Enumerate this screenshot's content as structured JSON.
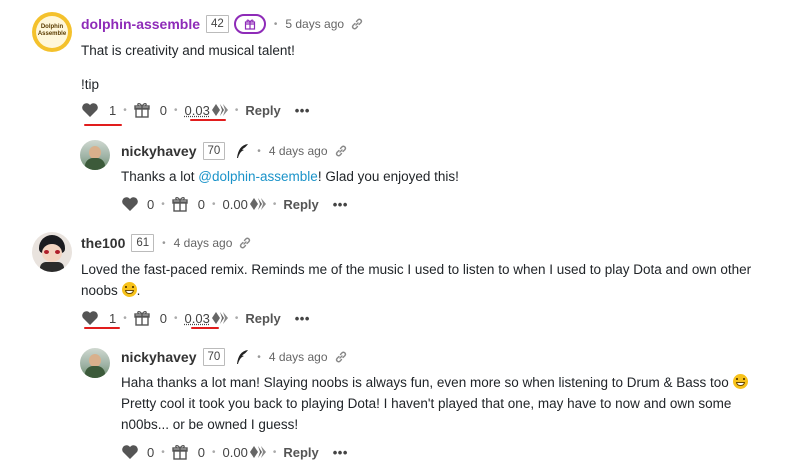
{
  "comments": [
    {
      "author": "dolphin-assemble",
      "reputation": "42",
      "time": "5 days ago",
      "avatar_text": "Dolphin Assemble",
      "body_line1": "That is creativity and musical talent!",
      "body_line2": "!tip",
      "votes": "1",
      "gifts": "0",
      "payout": "0.03",
      "reply": "Reply",
      "more": "•••"
    },
    {
      "author": "nickyhavey",
      "reputation": "70",
      "time": "4 days ago",
      "body_pre": "Thanks a lot ",
      "body_mention": "@dolphin-assemble",
      "body_post": "! Glad you enjoyed this!",
      "votes": "0",
      "gifts": "0",
      "payout": "0.00",
      "reply": "Reply",
      "more": "•••"
    },
    {
      "author": "the100",
      "reputation": "61",
      "time": "4 days ago",
      "body_line1": "Loved the fast-paced remix. Reminds me of the music I used to listen to when I used to play Dota and own other",
      "body_line2": "noobs",
      "body_line2_end": ".",
      "votes": "1",
      "gifts": "0",
      "payout": "0.03",
      "reply": "Reply",
      "more": "•••"
    },
    {
      "author": "nickyhavey",
      "reputation": "70",
      "time": "4 days ago",
      "body_line1": "Haha thanks a lot man! Slaying noobs is always fun, even more so when listening to Drum & Bass too",
      "body_line2": "Pretty cool it took you back to playing Dota! I haven't played that one, may have to now and own some",
      "body_line3": "n00bs... or be owned I guess!",
      "votes": "0",
      "gifts": "0",
      "payout": "0.00",
      "reply": "Reply",
      "more": "•••"
    }
  ],
  "colors": {
    "author_dolphin": "#8e2bb8",
    "author_default": "#333333",
    "mention": "#1a93c9",
    "annotation_red": "#e11d1d",
    "gift_badge": "#8e2bb8"
  },
  "icons": [
    "heart-icon",
    "gift-icon",
    "hive-icon",
    "link-icon",
    "feather-icon",
    "gift-badge-icon"
  ]
}
